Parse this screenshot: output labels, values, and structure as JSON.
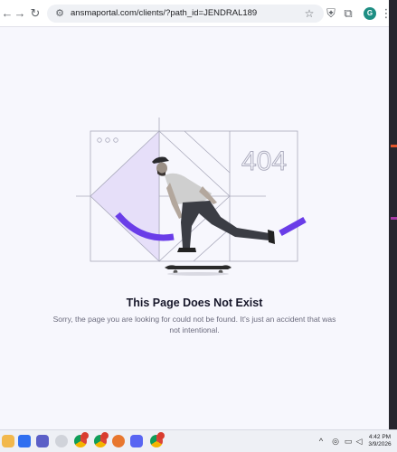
{
  "browser": {
    "url": "ansmaportal.com/clients/?path_id=JENDRAL189",
    "profile_initial": "G"
  },
  "illustration": {
    "code": "404",
    "accent_color": "#6a3de8",
    "panel_color": "#e6dff9"
  },
  "page": {
    "title": "This Page Does Not Exist",
    "message": "Sorry, the page you are looking for could not be found. It's just an accident that was not intentional."
  },
  "taskbar": {
    "time": "4:42 PM",
    "date": "3/9/2026"
  }
}
